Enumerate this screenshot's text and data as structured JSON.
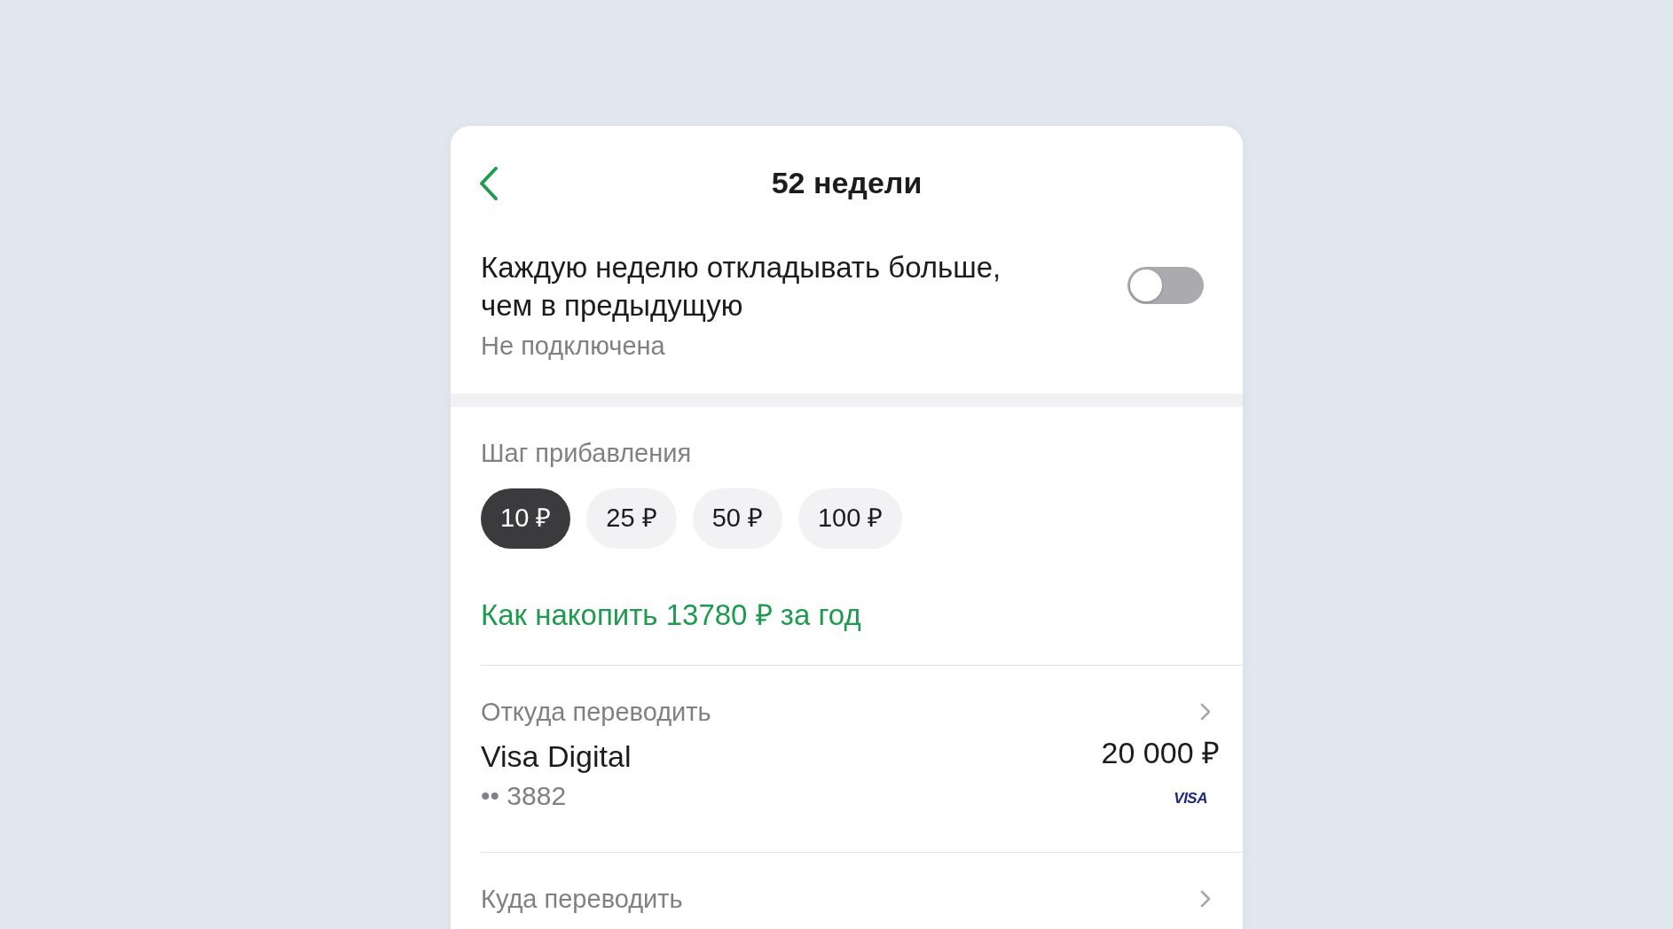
{
  "header": {
    "title": "52 недели"
  },
  "auto_increase": {
    "label": "Каждую неделю откладывать больше, чем в предыдущую",
    "status": "Не подключена",
    "on": false
  },
  "step": {
    "label": "Шаг прибавления",
    "options": [
      {
        "label": "10 ₽",
        "selected": true
      },
      {
        "label": "25 ₽",
        "selected": false
      },
      {
        "label": "50 ₽",
        "selected": false
      },
      {
        "label": "100 ₽",
        "selected": false
      }
    ]
  },
  "savings_link": "Как накопить 13780 ₽ за год",
  "transfer_from": {
    "label": "Откуда переводить",
    "account_name": "Visa Digital",
    "card_number": "•• 3882",
    "balance": "20 000 ₽",
    "card_brand": "VISA"
  },
  "transfer_to": {
    "label": "Куда переводить"
  }
}
